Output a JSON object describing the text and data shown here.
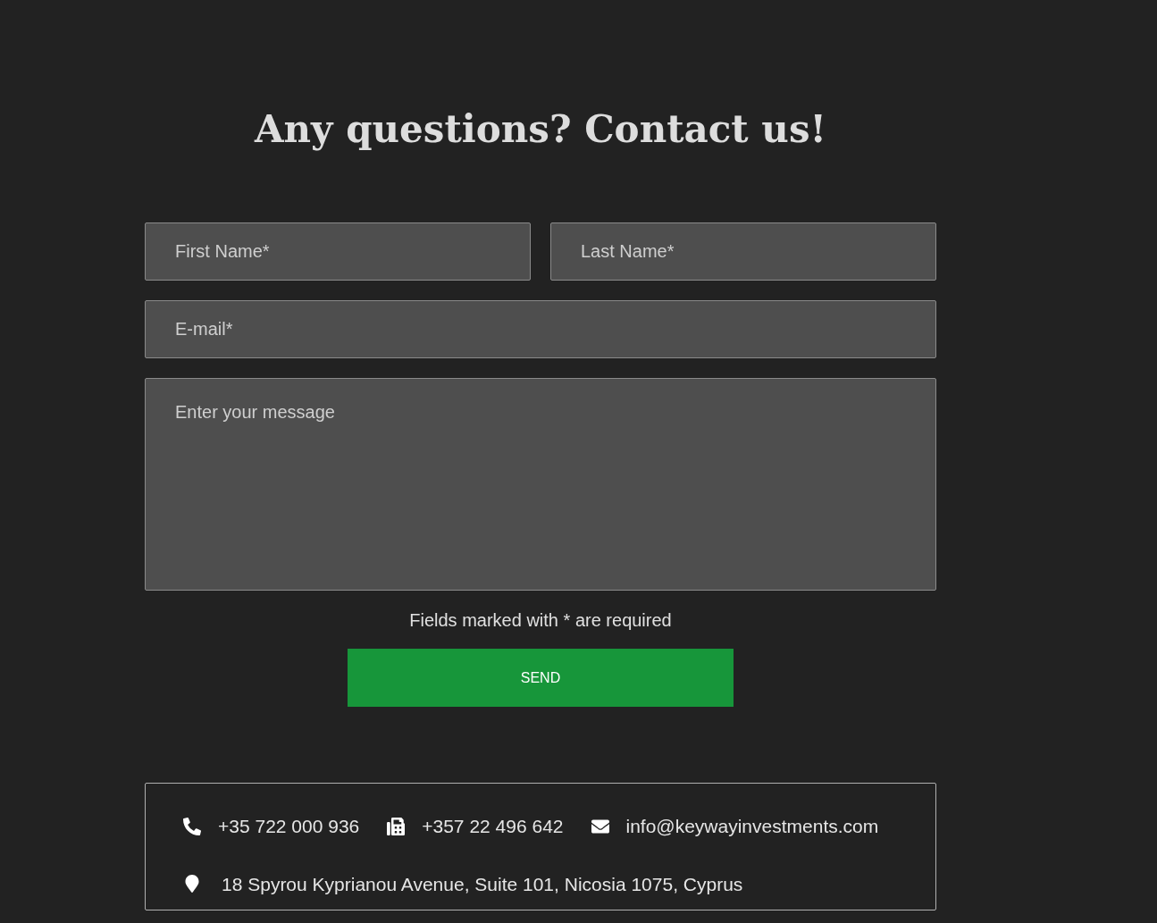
{
  "title": "Any questions? Contact us!",
  "fields": [
    {
      "kind": "half",
      "placeholder": "First Name*"
    },
    {
      "kind": "half",
      "placeholder": "Last Name*"
    },
    {
      "kind": "full",
      "placeholder": "E-mail*"
    },
    {
      "kind": "message",
      "placeholder": "Enter your message"
    }
  ],
  "note": "Fields marked with * are required",
  "button": "SEND",
  "contacts": [
    {
      "kind": "phone",
      "text": "+35 722 000 936"
    },
    {
      "kind": "fax",
      "text": "+357 22 496 642"
    },
    {
      "kind": "email",
      "text": "info@keywayinvestments.com"
    }
  ],
  "address": {
    "kind": "pin",
    "text": "18 Spyrou Kyprianou Avenue, Suite 101, Nicosia 1075, Cyprus"
  }
}
